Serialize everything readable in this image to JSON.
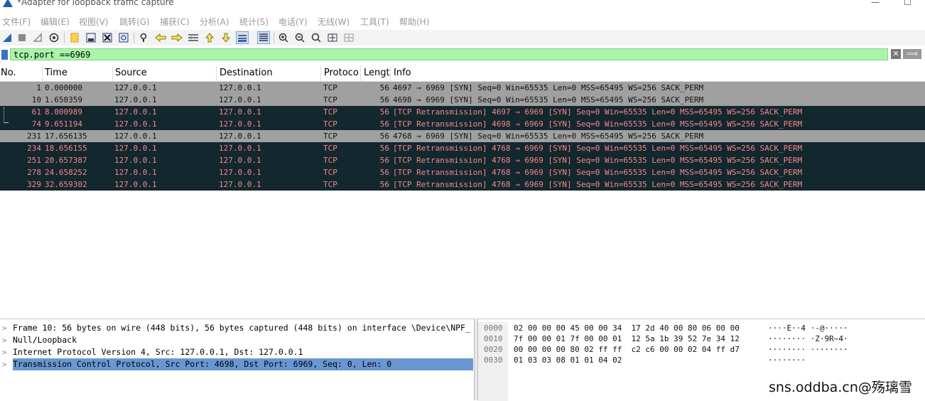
{
  "window": {
    "title": "*Adapter for loopback traffic capture",
    "minimize_glyph": "—",
    "maximize_glyph": "☐"
  },
  "menu": [
    "文件(F)",
    "编辑(E)",
    "视图(V)",
    "跳转(G)",
    "捕获(C)",
    "分析(A)",
    "统计(S)",
    "电话(Y)",
    "无线(W)",
    "工具(T)",
    "帮助(H)"
  ],
  "toolbar": {
    "icons": [
      "shark-fin-start-icon",
      "stop-icon",
      "restart-icon",
      "options-gear-icon",
      "open-file-icon",
      "save-file-icon",
      "close-file-icon",
      "reload-icon",
      "find-icon",
      "back-arrow-icon",
      "forward-arrow-icon",
      "go-to-packet-icon",
      "first-packet-icon",
      "last-packet-icon",
      "auto-scroll-icon",
      "colorize-icon",
      "zoom-in-icon",
      "zoom-out-icon",
      "zoom-reset-icon",
      "resize-columns-icon",
      "layout-icon"
    ]
  },
  "filter": {
    "value": "tcp.port ==6969",
    "clear_glyph": "✕",
    "apply_glyph": "⟹",
    "color": "#a8f5a8"
  },
  "columns": [
    "No.",
    "Time",
    "Source",
    "Destination",
    "Protoco",
    "Lengt",
    "Info"
  ],
  "colors": {
    "normal_bg": "#a0a0a0",
    "retrans_bg": "#12272e",
    "retrans_fg": "#f78787",
    "selected_detail": "#6a97d4"
  },
  "packets": [
    {
      "no": "1",
      "time": "0.000000",
      "src": "127.0.0.1",
      "dst": "127.0.0.1",
      "proto": "TCP",
      "len": "56",
      "info": "4697 → 6969 [SYN] Seq=0 Win=65535 Len=0 MSS=65495 WS=256 SACK_PERM",
      "style": "normal"
    },
    {
      "no": "10",
      "time": "1.650359",
      "src": "127.0.0.1",
      "dst": "127.0.0.1",
      "proto": "TCP",
      "len": "56",
      "info": "4698 → 6969 [SYN] Seq=0 Win=65535 Len=0 MSS=65495 WS=256 SACK_PERM",
      "style": "normal"
    },
    {
      "no": "61",
      "time": "8.000989",
      "src": "127.0.0.1",
      "dst": "127.0.0.1",
      "proto": "TCP",
      "len": "56",
      "info": "[TCP Retransmission] 4697 → 6969 [SYN] Seq=0 Win=65535 Len=0 MSS=65495 WS=256 SACK_PERM",
      "style": "retrans"
    },
    {
      "no": "74",
      "time": "9.651194",
      "src": "127.0.0.1",
      "dst": "127.0.0.1",
      "proto": "TCP",
      "len": "56",
      "info": "[TCP Retransmission] 4698 → 6969 [SYN] Seq=0 Win=65535 Len=0 MSS=65495 WS=256 SACK_PERM",
      "style": "retrans"
    },
    {
      "no": "231",
      "time": "17.656135",
      "src": "127.0.0.1",
      "dst": "127.0.0.1",
      "proto": "TCP",
      "len": "56",
      "info": "4768 → 6969 [SYN] Seq=0 Win=65535 Len=0 MSS=65495 WS=256 SACK_PERM",
      "style": "normal"
    },
    {
      "no": "234",
      "time": "18.656155",
      "src": "127.0.0.1",
      "dst": "127.0.0.1",
      "proto": "TCP",
      "len": "56",
      "info": "[TCP Retransmission] 4768 → 6969 [SYN] Seq=0 Win=65535 Len=0 MSS=65495 WS=256 SACK_PERM",
      "style": "retrans"
    },
    {
      "no": "251",
      "time": "20.657387",
      "src": "127.0.0.1",
      "dst": "127.0.0.1",
      "proto": "TCP",
      "len": "56",
      "info": "[TCP Retransmission] 4768 → 6969 [SYN] Seq=0 Win=65535 Len=0 MSS=65495 WS=256 SACK_PERM",
      "style": "retrans"
    },
    {
      "no": "278",
      "time": "24.658252",
      "src": "127.0.0.1",
      "dst": "127.0.0.1",
      "proto": "TCP",
      "len": "56",
      "info": "[TCP Retransmission] 4768 → 6969 [SYN] Seq=0 Win=65535 Len=0 MSS=65495 WS=256 SACK_PERM",
      "style": "retrans"
    },
    {
      "no": "329",
      "time": "32.659302",
      "src": "127.0.0.1",
      "dst": "127.0.0.1",
      "proto": "TCP",
      "len": "56",
      "info": "[TCP Retransmission] 4768 → 6969 [SYN] Seq=0 Win=65535 Len=0 MSS=65495 WS=256 SACK_PERM",
      "style": "retrans"
    }
  ],
  "details": [
    {
      "text": "Frame 10: 56 bytes on wire (448 bits), 56 bytes captured (448 bits) on interface \\Device\\NPF_",
      "selected": false
    },
    {
      "text": "Null/Loopback",
      "selected": false
    },
    {
      "text": "Internet Protocol Version 4, Src: 127.0.0.1, Dst: 127.0.0.1",
      "selected": false
    },
    {
      "text": "Transmission Control Protocol, Src Port: 4698, Dst Port: 6969, Seq: 0, Len: 0",
      "selected": true
    }
  ],
  "bytes": [
    {
      "offset": "0000",
      "hex": "02 00 00 00 45 00 00 34  17 2d 40 00 80 06 00 00",
      "ascii": "····E··4 ·-@·····"
    },
    {
      "offset": "0010",
      "hex": "7f 00 00 01 7f 00 00 01  12 5a 1b 39 52 7e 34 12",
      "ascii": "········ ·Z·9R~4·"
    },
    {
      "offset": "0020",
      "hex": "00 00 00 00 80 02 ff ff  c2 c6 00 00 02 04 ff d7",
      "ascii": "········ ········"
    },
    {
      "offset": "0030",
      "hex": "01 03 03 08 01 01 04 02",
      "ascii": "········"
    }
  ],
  "watermark": "sns.oddba.cn@殇璃雪"
}
